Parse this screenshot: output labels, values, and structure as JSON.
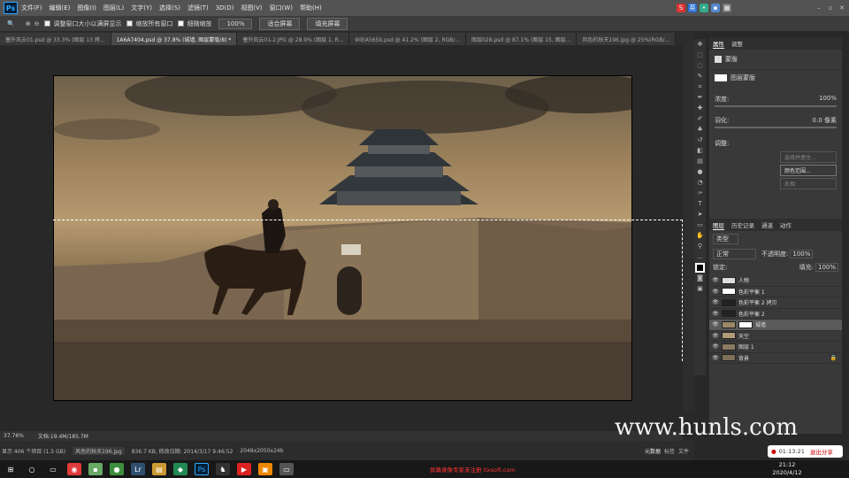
{
  "app": {
    "name": "Ps"
  },
  "menu": [
    "文件(F)",
    "编辑(E)",
    "图像(I)",
    "图层(L)",
    "文字(Y)",
    "选择(S)",
    "滤镜(T)",
    "3D(D)",
    "视图(V)",
    "窗口(W)",
    "帮助(H)"
  ],
  "options": {
    "resize_windows": "调整窗口大小以满屏显示",
    "zoom_all": "缩放所有窗口",
    "scrubby": "细微缩放",
    "pct": "100%",
    "fit": "适合屏幕",
    "fill": "填充屏幕"
  },
  "tabs": [
    "塞外风云01.psd @ 33.3% (图层 13 拷...",
    "1A6A7404.psd @ 37.8% (城墙, 图层蒙版/8) *",
    "塞外风云01-2.JPG @ 28.9% (图层 1, R...",
    "90EA5659.psd @ 41.2% (图层 2, RGB/...",
    "图层028.psd @ 87.1% (图层 15, 图层...",
    "风色的秋天196.jpg @ 25%(RGB/..."
  ],
  "properties": {
    "tabs": [
      "属性",
      "调整"
    ],
    "title": "蒙版",
    "layer_mask": "图层蒙版",
    "density_label": "浓度:",
    "density": "100%",
    "feather_label": "羽化:",
    "feather": "0.0 像素",
    "adjust_label": "调整:",
    "btn_edge": "选择并遮住...",
    "btn_color": "颜色范围...",
    "btn_invert": "反相"
  },
  "layers": {
    "tabs": [
      "图层",
      "历史记录",
      "通道",
      "动作"
    ],
    "kind": "类型",
    "blend": "正常",
    "opacity_label": "不透明度:",
    "opacity": "100%",
    "lock_label": "锁定:",
    "fill_label": "填充:",
    "fill": "100%",
    "items": [
      {
        "name": "人物"
      },
      {
        "name": "色彩平衡 1"
      },
      {
        "name": "色彩平衡 2 拷贝"
      },
      {
        "name": "色彩平衡 2"
      },
      {
        "name": "城墙"
      },
      {
        "name": "天空"
      },
      {
        "name": "图层 1"
      },
      {
        "name": "背景"
      }
    ]
  },
  "status": {
    "zoom": "37.76%",
    "doc": "文档:19.4M/185.7M"
  },
  "bridge": {
    "count": "显示 406 个项目 (1.5 GB)",
    "file": "风色的秋天196.jpg",
    "size": "836.7 KB, 修改日期: 2014/3/17 9:46:52",
    "dims": "2048x2050x24b"
  },
  "bottom_tabs": [
    "元数据",
    "标签",
    "文件"
  ],
  "watermark": "www.hunls.com",
  "recorder": {
    "time": "01:13:21",
    "stop": "退出分享"
  },
  "clock": {
    "time": "21:12",
    "date": "2020/4/12"
  },
  "taskbar_notice": "屏幕录像专家未注册 tlxsoft.com"
}
